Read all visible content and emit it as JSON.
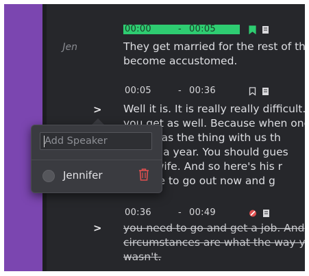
{
  "segments": [
    {
      "speaker": "Jen",
      "start": "00:00",
      "end": "00:05",
      "active": true,
      "icons": [
        "bookmark-icon",
        "note-icon"
      ],
      "lines": [
        "They get married for the rest of th",
        "become accustomed."
      ]
    },
    {
      "speaker": ">",
      "start": "00:05",
      "end": "00:36",
      "icons": [
        "bookmark-outline-icon",
        "note-icon"
      ],
      "lines": [
        "Well it is. It is really really difficult.",
        "you get as well. Because when one",
        "what was the thing with us th",
        "maybe a year. You should gues",
        "housewife. And so here's his r",
        "capable to go out now and g"
      ]
    },
    {
      "speaker": ">",
      "start": "00:36",
      "end": "00:49",
      "icons": [
        "blocked-icon",
        "note-icon"
      ],
      "struck": true,
      "lines": [
        "you need to go and get a job. And",
        "circumstances are what the way y",
        "wasn't."
      ]
    }
  ],
  "time_separator": "-",
  "popup": {
    "input_placeholder": "Add Speaker",
    "speaker_option": "Jennifer"
  },
  "colors": {
    "accent_purple": "#7b46b0",
    "active_time_green": "#2ecc71",
    "delete_red": "#e05050"
  }
}
